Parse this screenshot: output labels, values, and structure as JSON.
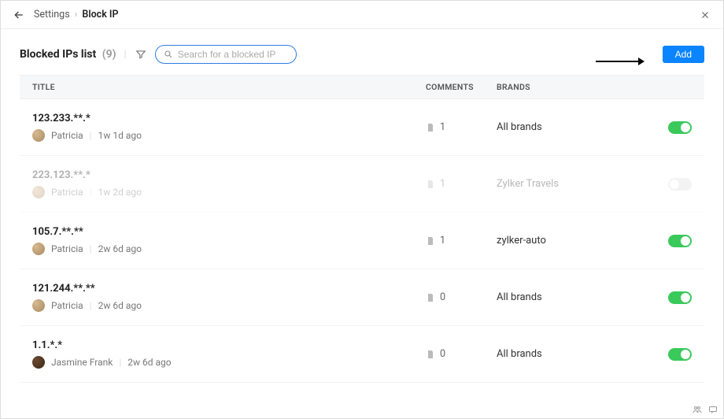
{
  "breadcrumb": {
    "parent": "Settings",
    "current": "Block IP"
  },
  "header": {
    "title": "Blocked IPs list",
    "count": "(9)",
    "search_placeholder": "Search for a blocked IP",
    "add_label": "Add"
  },
  "columns": {
    "title": "TITLE",
    "comments": "COMMENTS",
    "brands": "BRANDS"
  },
  "rows": [
    {
      "ip": "123.233.**.*",
      "author": "Patricia",
      "avatar": "p",
      "age": "1w 1d ago",
      "comments": "1",
      "brands": "All brands",
      "enabled": true,
      "disabled_row": false
    },
    {
      "ip": "223.123.**.*",
      "author": "Patricia",
      "avatar": "p",
      "age": "1w 2d ago",
      "comments": "1",
      "brands": "Zylker Travels",
      "enabled": false,
      "disabled_row": true
    },
    {
      "ip": "105.7.**.**",
      "author": "Patricia",
      "avatar": "p",
      "age": "2w 6d ago",
      "comments": "1",
      "brands": "zylker-auto",
      "enabled": true,
      "disabled_row": false
    },
    {
      "ip": "121.244.**.**",
      "author": "Patricia",
      "avatar": "p",
      "age": "2w 6d ago",
      "comments": "0",
      "brands": "All brands",
      "enabled": true,
      "disabled_row": false
    },
    {
      "ip": "1.1.*.*",
      "author": "Jasmine Frank",
      "avatar": "j",
      "age": "2w 6d ago",
      "comments": "0",
      "brands": "All brands",
      "enabled": true,
      "disabled_row": false
    }
  ]
}
